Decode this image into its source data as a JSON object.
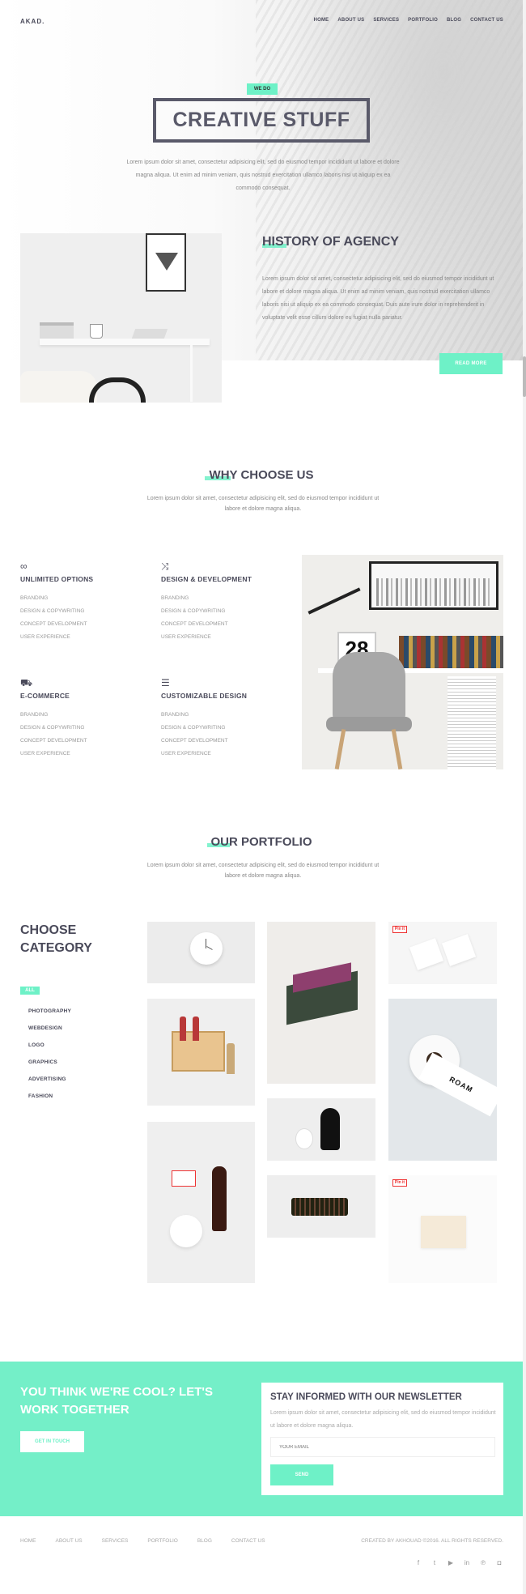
{
  "header": {
    "logo": "AKAD.",
    "nav": [
      "HOME",
      "ABOUT US",
      "SERVICES",
      "PORTFOLIO",
      "BLOG",
      "CONTACT US"
    ]
  },
  "hero": {
    "tag": "WE DO",
    "title": "CREATIVE STUFF",
    "text": "Lorem ipsum dolor sit amet, consectetur adipisicing elit, sed do eiusmod tempor incididunt ut labore et dolore magna aliqua. Ut enim ad minim veniam, quis nostrud exercitation ullamco laboris nisi ut aliquip ex ea commodo consequat."
  },
  "history": {
    "title": "HISTORY OF AGENCY",
    "text": "Lorem ipsum dolor sit amet, consectetur adipisicing elit, sed do eiusmod tempor incididunt ut labore et dolore magna aliqua. Ut enim ad minim veniam, quis nostrud exercitation ullamco laboris nisi ut aliquip ex ea commodo consequat. Duis aute irure dolor in reprehenderit in voluptate velit esse cillum dolore eu fugiat nulla pariatur.",
    "button": "READ MORE"
  },
  "why": {
    "title": "WHY CHOOSE US",
    "subtitle": "Lorem ipsum dolor sit amet, consectetur adipisicing elit, sed do eiusmod tempor incididunt ut labore et dolore magna aliqua.",
    "features": [
      {
        "icon": "infinity-icon",
        "title": "UNLIMITED OPTIONS",
        "items": [
          "BRANDING",
          "DESIGN & COPYWRITING",
          "CONCEPT DEVELOPMENT",
          "USER EXPERIENCE"
        ]
      },
      {
        "icon": "shuffle-icon",
        "title": "DESIGN & DEVELOPMENT",
        "items": [
          "BRANDING",
          "DESIGN & COPYWRITING",
          "CONCEPT DEVELOPMENT",
          "USER EXPERIENCE"
        ]
      },
      {
        "icon": "cart-icon",
        "title": "E-COMMERCE",
        "items": [
          "BRANDING",
          "DESIGN & COPYWRITING",
          "CONCEPT DEVELOPMENT",
          "USER EXPERIENCE"
        ]
      },
      {
        "icon": "sliders-icon",
        "title": "CUSTOMIZABLE DESIGN",
        "items": [
          "BRANDING",
          "DESIGN & COPYWRITING",
          "CONCEPT DEVELOPMENT",
          "USER EXPERIENCE"
        ]
      }
    ],
    "calendar_number": "28"
  },
  "portfolio": {
    "title": "OUR PORTFOLIO",
    "subtitle": "Lorem ipsum dolor sit amet, consectetur adipisicing elit, sed do eiusmod tempor incididunt ut labore et dolore magna aliqua.",
    "category_title": "CHOOSE CATEGORY",
    "active_category": "ALL",
    "categories": [
      "PHOTOGRAPHY",
      "WEBDESIGN",
      "LOGO",
      "GRAPHICS",
      "ADVERTISING",
      "FASHION"
    ],
    "pin_label": "Pin it",
    "tape_label": "ROAM"
  },
  "cta": {
    "text": "YOU THINK WE'RE COOL? LET'S WORK TOGETHER",
    "button": "GET IN TOUCH",
    "newsletter_title": "STAY INFORMED WITH OUR NEWSLETTER",
    "newsletter_text": "Lorem ipsum dolor sit amet, consectetur adipisicing elit, sed do eiusmod tempor incididunt ut labore et dolore magna aliqua.",
    "email_placeholder": "YOUR EMAIL",
    "send": "SEND"
  },
  "footer": {
    "nav": [
      "HOME",
      "ABOUT US",
      "SERVICES",
      "PORTFOLIO",
      "BLOG",
      "CONTACT US"
    ],
    "copyright": "CREATED BY AKHOUAD ©2016. ALL RIGHTS RESERVED.",
    "social": [
      "facebook-icon",
      "twitter-icon",
      "youtube-icon",
      "linkedin-icon",
      "pinterest-icon",
      "instagram-icon"
    ]
  },
  "colors": {
    "accent": "#6ef1c7",
    "text": "#4a4a5a",
    "muted": "#888888"
  }
}
